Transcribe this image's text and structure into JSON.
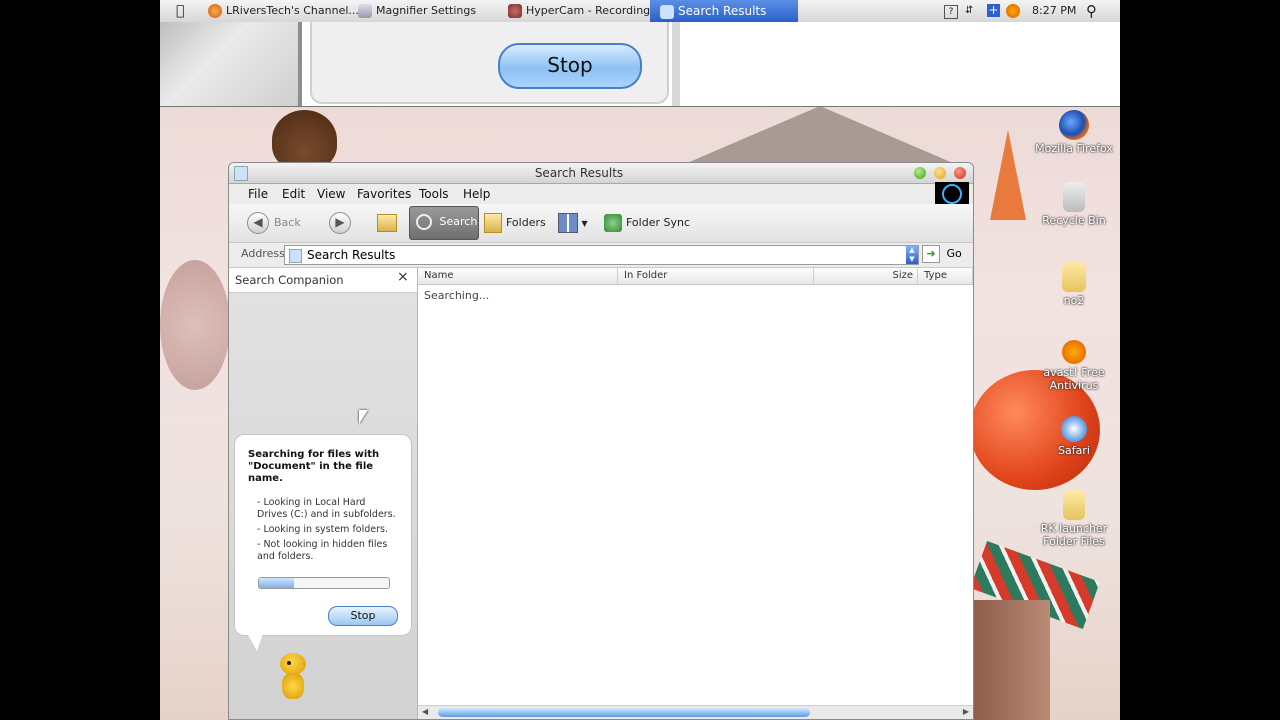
{
  "taskbar": {
    "items": [
      {
        "label": "LRiversTech's Channel...",
        "active": false
      },
      {
        "label": "Magnifier Settings",
        "active": false
      },
      {
        "label": "HyperCam - Recording",
        "active": false
      },
      {
        "label": "Search Results",
        "active": true
      }
    ],
    "clock": "8:27 PM"
  },
  "magnifier": {
    "stop_label": "Stop"
  },
  "window": {
    "title": "Search Results",
    "menu": [
      "File",
      "Edit",
      "View",
      "Favorites",
      "Tools",
      "Help"
    ],
    "toolbar": {
      "back": "Back",
      "search": "Search",
      "folders": "Folders",
      "folder_sync": "Folder Sync"
    },
    "address": {
      "label": "Address",
      "value": "Search Results",
      "go": "Go"
    },
    "left_pane": {
      "title": "Search Companion",
      "close": "×",
      "heading": "Searching for files with \"Document\" in the file name.",
      "details": [
        "- Looking in Local Hard Drives (C:) and in subfolders.",
        "- Looking in system folders.",
        "- Not looking in hidden files and folders."
      ],
      "progress": 0.27,
      "stop": "Stop"
    },
    "results": {
      "columns": [
        "Name",
        "In Folder",
        "Size",
        "Type"
      ],
      "status": "Searching..."
    }
  },
  "desktop_icons": [
    {
      "label": "Mozilla Firefox"
    },
    {
      "label": "Recycle Bin"
    },
    {
      "label": "no2"
    },
    {
      "label": "avast! Free Antivirus"
    },
    {
      "label": "Safari"
    },
    {
      "label": "RK launcher Folder Files"
    }
  ],
  "colors": {
    "accent": "#2a5fc9",
    "button_blue": "#9cc8f2"
  }
}
